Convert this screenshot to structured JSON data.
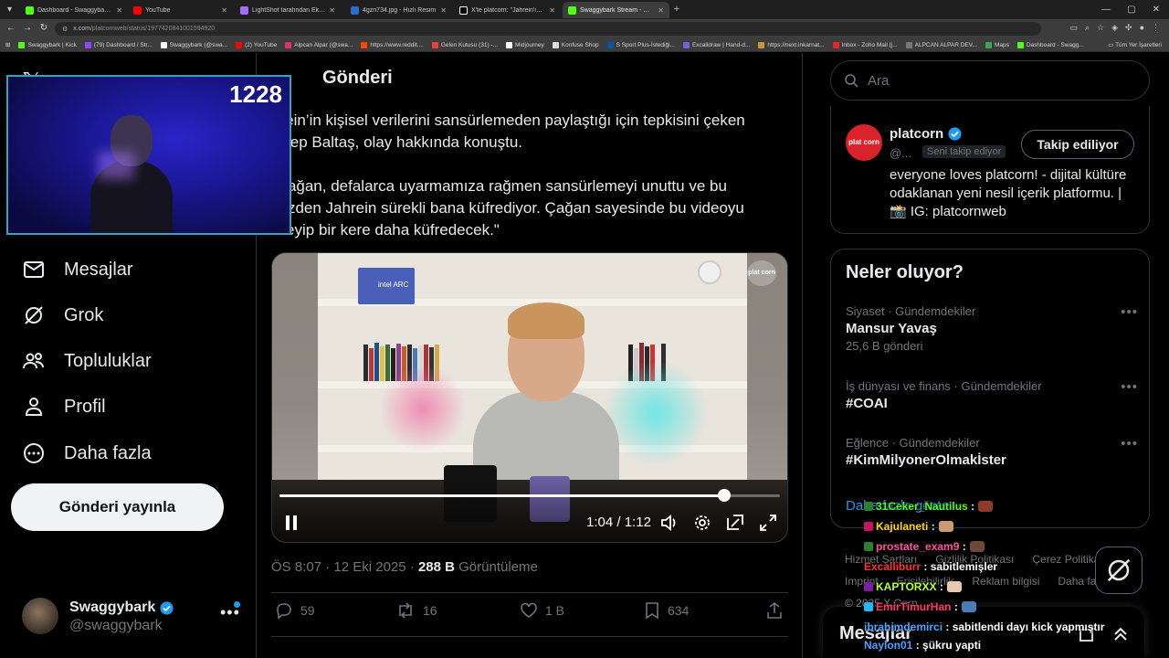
{
  "browser": {
    "tabs": [
      {
        "title": "Dashboard - Swaggybark Link",
        "color": "#53fc18"
      },
      {
        "title": "YouTube",
        "color": "#ff0000"
      },
      {
        "title": "LightShot tarafından Ekran Görü",
        "color": "#a46cff"
      },
      {
        "title": "4gzn734.jpg - Hızlı Resim",
        "color": "#2b6cd1"
      },
      {
        "title": "X'te platcorn: \"Jahrein'in kişi",
        "color": "#ffffff"
      },
      {
        "title": "Swaggybark Stream - Watch Liv",
        "color": "#53fc18"
      }
    ],
    "url_host": "x.com",
    "url_path": "/platcornweb/status/1977420841001594920",
    "bookmarks": [
      {
        "label": "Swaggybark | Kick",
        "color": "#53fc18"
      },
      {
        "label": "(79) Dashboard / Str...",
        "color": "#9146ff"
      },
      {
        "label": "Swaggybark (@swa...",
        "color": "#ffffff"
      },
      {
        "label": "(2) YouTube",
        "color": "#ff0000"
      },
      {
        "label": "Alpcan Alpar (@swa...",
        "color": "#e1306c"
      },
      {
        "label": "https://www.reddit....",
        "color": "#ff4500"
      },
      {
        "label": "Gelen Kutusu (31) -...",
        "color": "#ea4335"
      },
      {
        "label": "Midjourney",
        "color": "#ffffff"
      },
      {
        "label": "Konfuse Shop",
        "color": "#dddddd"
      },
      {
        "label": "S Sport Plus-İstediği...",
        "color": "#0057a8"
      },
      {
        "label": "Excalidraw | Hand-d...",
        "color": "#6965db"
      },
      {
        "label": "https://next.inkarnat...",
        "color": "#c19a3a"
      },
      {
        "label": "Inbox - Zoho Mail (j...",
        "color": "#e42527"
      },
      {
        "label": "ALPCAN ALPAR DEV...",
        "color": "#2c2c2c"
      },
      {
        "label": "Maps",
        "color": "#34a853"
      },
      {
        "label": "Dashboard - Swagg...",
        "color": "#53fc18"
      }
    ],
    "all_bookmarks": "Tüm Yer İşaretleri"
  },
  "sidebar": {
    "x_logo": "𝕏",
    "items": [
      {
        "label": "Mesajlar",
        "icon": "mail-icon"
      },
      {
        "label": "Grok",
        "icon": "grok-icon"
      },
      {
        "label": "Topluluklar",
        "icon": "communities-icon"
      },
      {
        "label": "Profil",
        "icon": "profile-icon"
      },
      {
        "label": "Daha fazla",
        "icon": "more-circle-icon"
      }
    ],
    "post_button": "Gönderi yayınla",
    "account": {
      "name": "Swaggybark",
      "handle": "@swaggybark"
    }
  },
  "main": {
    "title": "Gönderi",
    "tweet_text": "hrein’in kişisel verilerini sansürlemeden paylaştığı için tepkisini çeken\nCcep Baltaş, olay hakkında konuştu.\n\n“Çağan, defalarca uyarmamıza rağmen sansürlemeyi unuttu ve bu\nyüzden Jahrein sürekli bana küfrediyor. Çağan sayesinde bu videoyu\nizleyip bir kere daha küfredecek.\"",
    "video": {
      "current_time": "1:04",
      "duration": "1:12",
      "progress": 0.889,
      "watermark": "plat corn",
      "brand_box": "intel ARC"
    },
    "meta_time": "ÖS 8:07 · 12 Eki 2025 ·",
    "views_count": "288 B",
    "views_label": "Görüntüleme",
    "actions": {
      "replies": "59",
      "reposts": "16",
      "likes": "1 B",
      "bookmarks": "634"
    }
  },
  "right": {
    "search_placeholder": "Ara",
    "profile": {
      "name": "platcorn",
      "handle": "@...",
      "follows_you": "Seni takip ediyor",
      "button": "Takip ediliyor",
      "bio": "everyone loves platcorn! - dijital kültüre odaklanan yeni nesil içerik platformu. | 📸 IG: platcornweb",
      "avatar_text": "plat corn"
    },
    "trends_title": "Neler oluyor?",
    "trends": [
      {
        "category": "Siyaset · Gündemdekiler",
        "name": "Mansur Yavaş",
        "count": "25,6 B gönderi"
      },
      {
        "category": "İş dünyası ve finans · Gündemdekiler",
        "name": "#COAI",
        "count": ""
      },
      {
        "category": "Eğlence · Gündemdekiler",
        "name": "#KimMilyonerOlmakİster",
        "count": ""
      }
    ],
    "show_more": "Daha fazla göster",
    "footer": [
      "Hizmet Şartları",
      "Gizlilik Politikası",
      "Çerez Politikası",
      "Imprint",
      "Erişilebilirlik",
      "Reklam bilgisi",
      "Daha fazla ...",
      "© 2025 X Corp."
    ],
    "messages_dock": "Mesajlar"
  },
  "overlay": {
    "viewer_count": "1228",
    "chat": [
      {
        "user": "31Ceker_Nautilus",
        "color": "#53fc18",
        "msg": ":",
        "badge": "#2e7d32"
      },
      {
        "user": "Kajulaneti",
        "color": "#ffd700",
        "msg": ":",
        "badge": "#c2185b"
      },
      {
        "user": "prostate_exam9",
        "color": "#ff4fa3",
        "msg": ":",
        "badge": "#2e7d32"
      },
      {
        "user": "Excalliburr",
        "color": "#ff3030",
        "msg": ": sabitlemişler",
        "badge": ""
      },
      {
        "user": "KAPTORXX",
        "color": "#b7ff2a",
        "msg": ":",
        "badge": "#7b1fa2"
      },
      {
        "user": "EmirTimurHan",
        "color": "#ff3b6b",
        "msg": ":",
        "badge": "#29b6f6"
      },
      {
        "user": "ibrahimdemirci",
        "color": "#4aa3ff",
        "msg": ": sabitlendi dayı kick yapmıştır",
        "badge": ""
      },
      {
        "user": "Naylon01",
        "color": "#4aa3ff",
        "msg": ": şükru yapti",
        "badge": ""
      }
    ]
  }
}
